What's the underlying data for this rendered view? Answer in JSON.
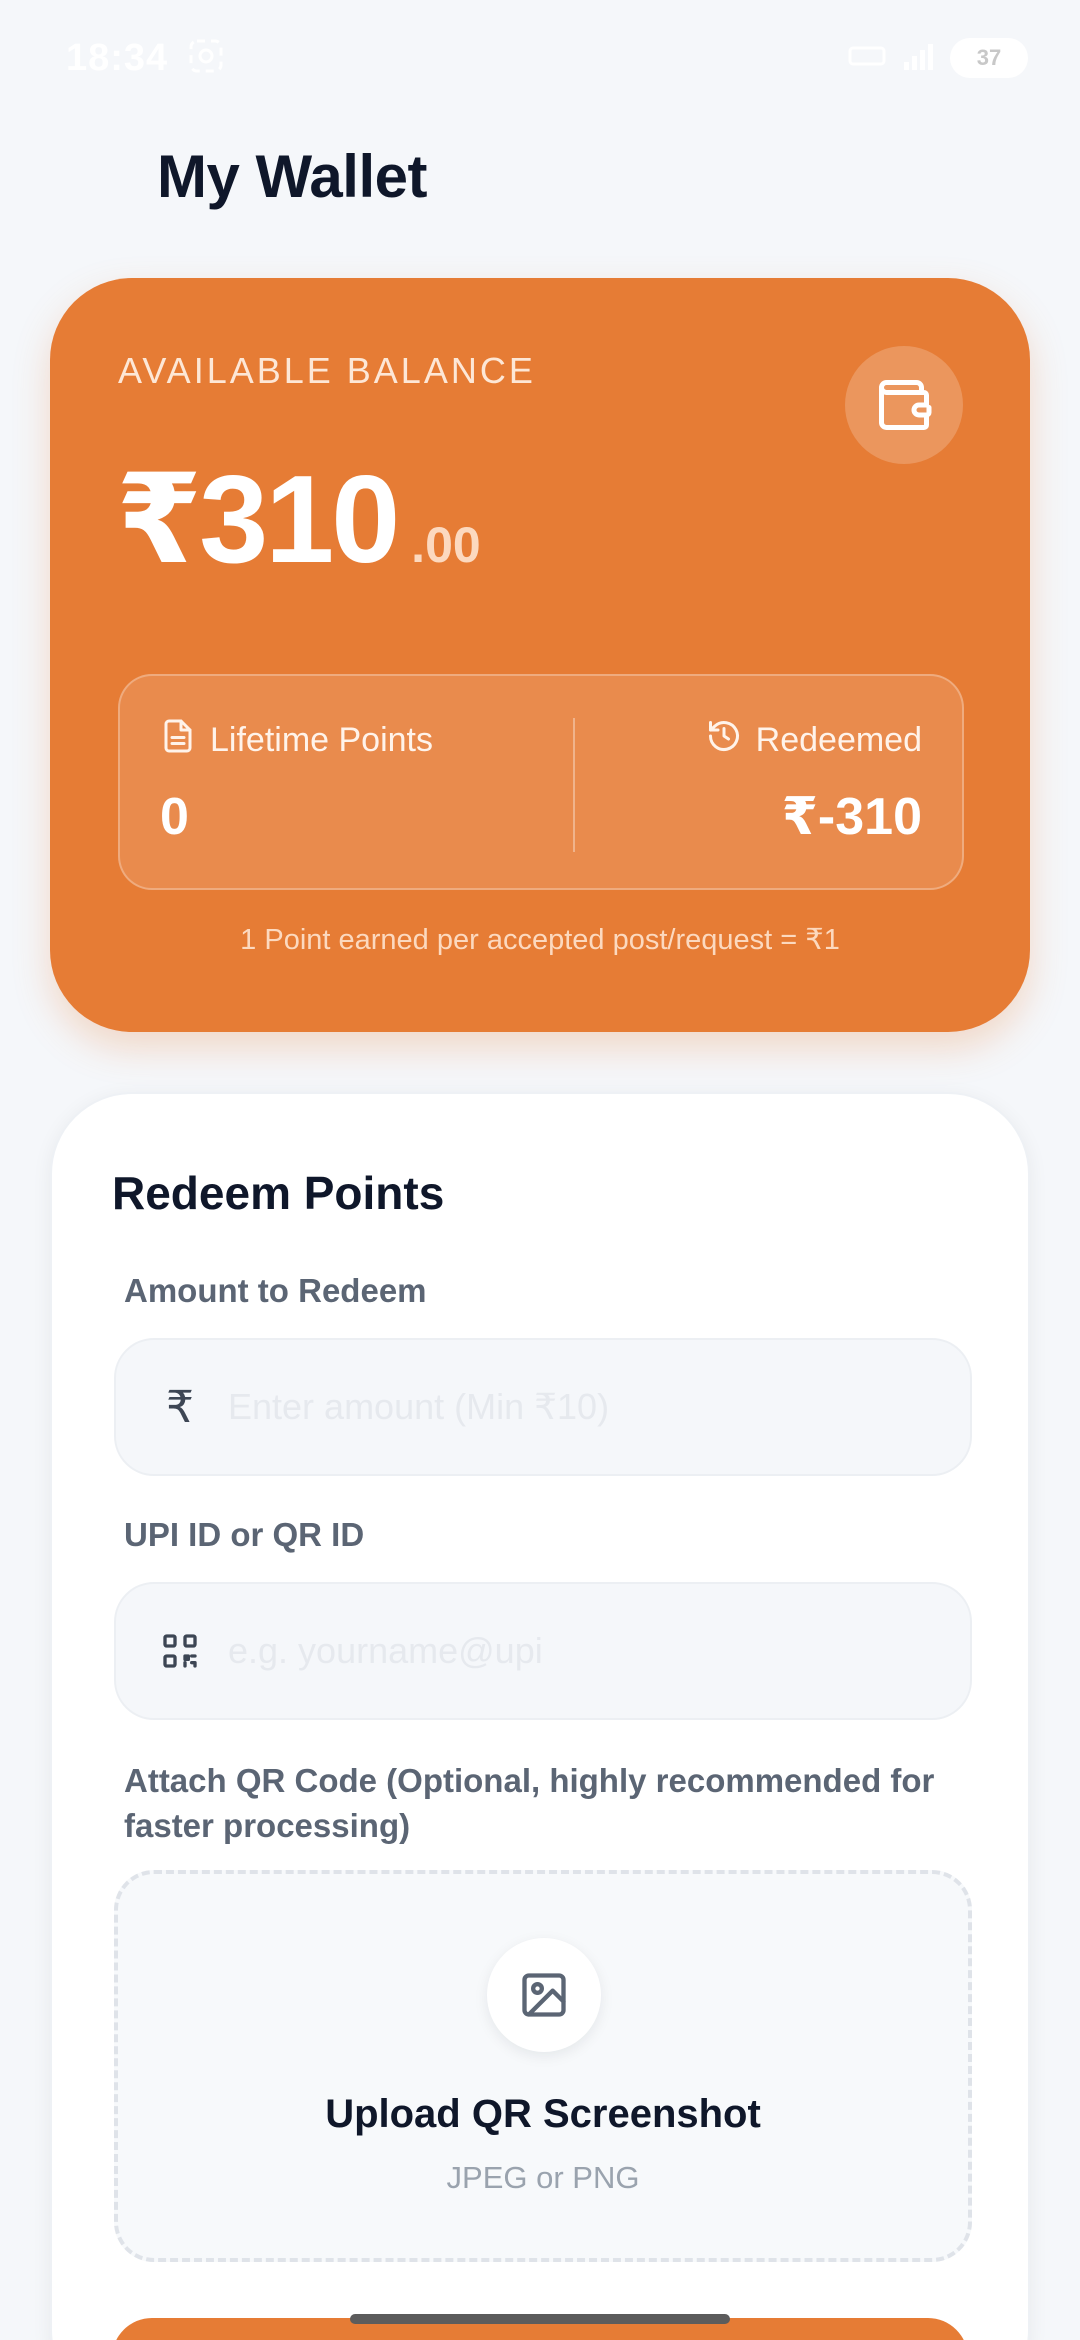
{
  "status_bar": {
    "time": "18:34",
    "battery": "37"
  },
  "page": {
    "title": "My Wallet"
  },
  "balance_card": {
    "label": "AVAILABLE BALANCE",
    "amount": "₹310",
    "decimal": ".00",
    "lifetime_points_label": "Lifetime Points",
    "lifetime_points_value": "0",
    "redeemed_label": "Redeemed",
    "redeemed_value": "₹-310",
    "note": "1 Point earned per accepted post/request = ₹1",
    "color": "#e67c35"
  },
  "redeem": {
    "title": "Redeem Points",
    "amount_label": "Amount to Redeem",
    "amount_symbol": "₹",
    "amount_placeholder": "Enter amount (Min ₹10)",
    "upi_label": "UPI ID or QR ID",
    "upi_placeholder": "e.g. yourname@upi",
    "attach_label": "Attach QR Code (Optional, highly recommended for faster processing)",
    "upload_title": "Upload QR Screenshot",
    "upload_sub": "JPEG or PNG"
  },
  "icons": {
    "wallet": "wallet-icon",
    "document": "document-icon",
    "history": "history-icon",
    "qr": "qr-code-icon",
    "image": "image-icon"
  }
}
